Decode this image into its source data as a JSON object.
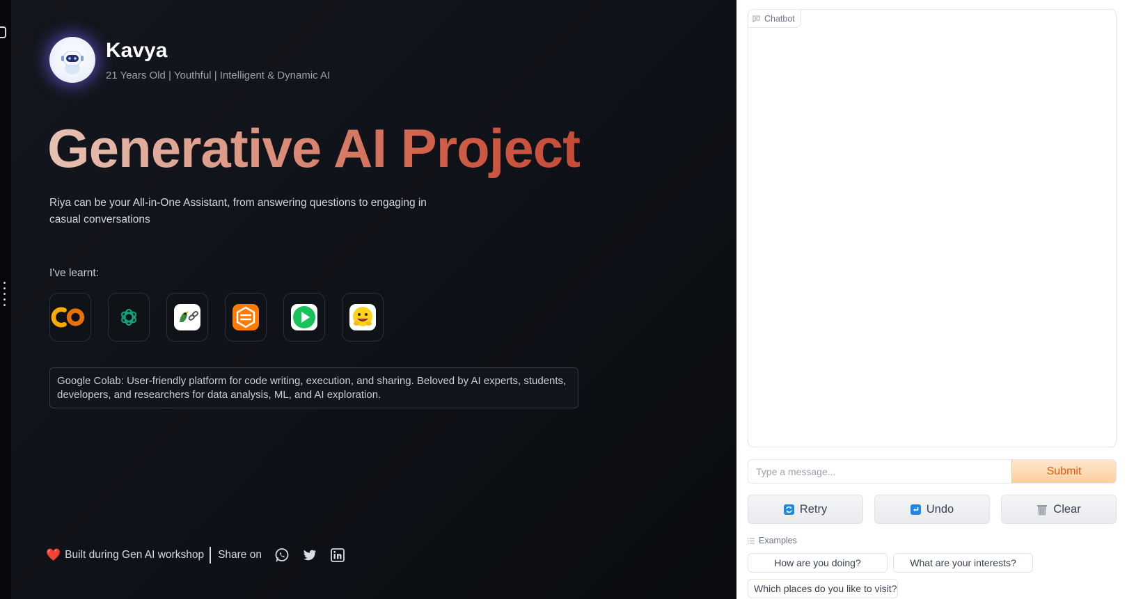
{
  "profile": {
    "name": "Kavya",
    "tagline": "21 Years Old | Youthful | Intelligent & Dynamic AI"
  },
  "hero": {
    "title": "Generative AI Project",
    "description": "Riya can be your All-in-One Assistant, from answering questions to engaging in casual conversations"
  },
  "skills": {
    "label": "I've learnt:",
    "tools": [
      {
        "icon": "google-colab-icon"
      },
      {
        "icon": "openai-icon"
      },
      {
        "icon": "langchain-icon"
      },
      {
        "icon": "stackblitz-icon"
      },
      {
        "icon": "play-icon"
      },
      {
        "icon": "hugging-face-icon"
      }
    ],
    "selected_description": "Google Colab: User-friendly platform for code writing, execution, and sharing. Beloved by AI experts, students, developers, and researchers for data analysis, ML, and AI exploration."
  },
  "footer": {
    "heart": "❤️",
    "built_text": "Built during Gen AI workshop",
    "share_text": "Share on",
    "social_icons": [
      "whatsapp-icon",
      "twitter-icon",
      "linkedin-icon"
    ]
  },
  "chat": {
    "label": "Chatbot",
    "input_placeholder": "Type a message...",
    "input_value": "",
    "submit_label": "Submit",
    "retry_label": "Retry",
    "undo_label": "Undo",
    "clear_label": "Clear",
    "examples_label": "Examples",
    "examples": [
      "How are you doing?",
      "What are your interests?",
      "Which places do you like to visit?"
    ]
  },
  "colors": {
    "accent": "#ea580c",
    "title_gradient_start": "#e7c2b4",
    "title_gradient_end": "#c64c37",
    "avatar_glow": "#7b5cff"
  }
}
